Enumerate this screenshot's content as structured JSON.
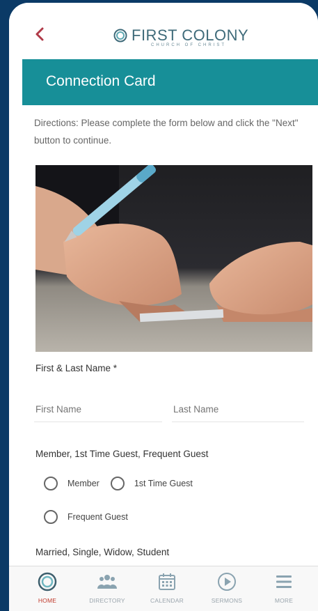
{
  "header": {
    "brand_name": "FIRST COLONY",
    "brand_sub": "CHURCH OF CHRIST",
    "title": "Connection Card"
  },
  "form": {
    "directions": "Directions: Please complete the form below and click the \"Next\" button to continue.",
    "name_label": "First & Last Name *",
    "first_name_placeholder": "First Name",
    "last_name_placeholder": "Last Name",
    "guest_question": "Member, 1st Time Guest, Frequent Guest",
    "guest_options": [
      "Member",
      "1st Time Guest",
      "Frequent Guest"
    ],
    "status_question": "Married, Single, Widow, Student"
  },
  "tabs": [
    {
      "label": "HOME",
      "icon": "home-logo-icon",
      "active": true
    },
    {
      "label": "DIRECTORY",
      "icon": "people-icon",
      "active": false
    },
    {
      "label": "CALENDAR",
      "icon": "calendar-icon",
      "active": false
    },
    {
      "label": "SERMONS",
      "icon": "play-circle-icon",
      "active": false
    },
    {
      "label": "MORE",
      "icon": "menu-icon",
      "active": false
    }
  ],
  "colors": {
    "accent": "#178f98",
    "back_arrow": "#b03a48",
    "active_tab": "#c0392b",
    "background": "#0b3a66"
  }
}
